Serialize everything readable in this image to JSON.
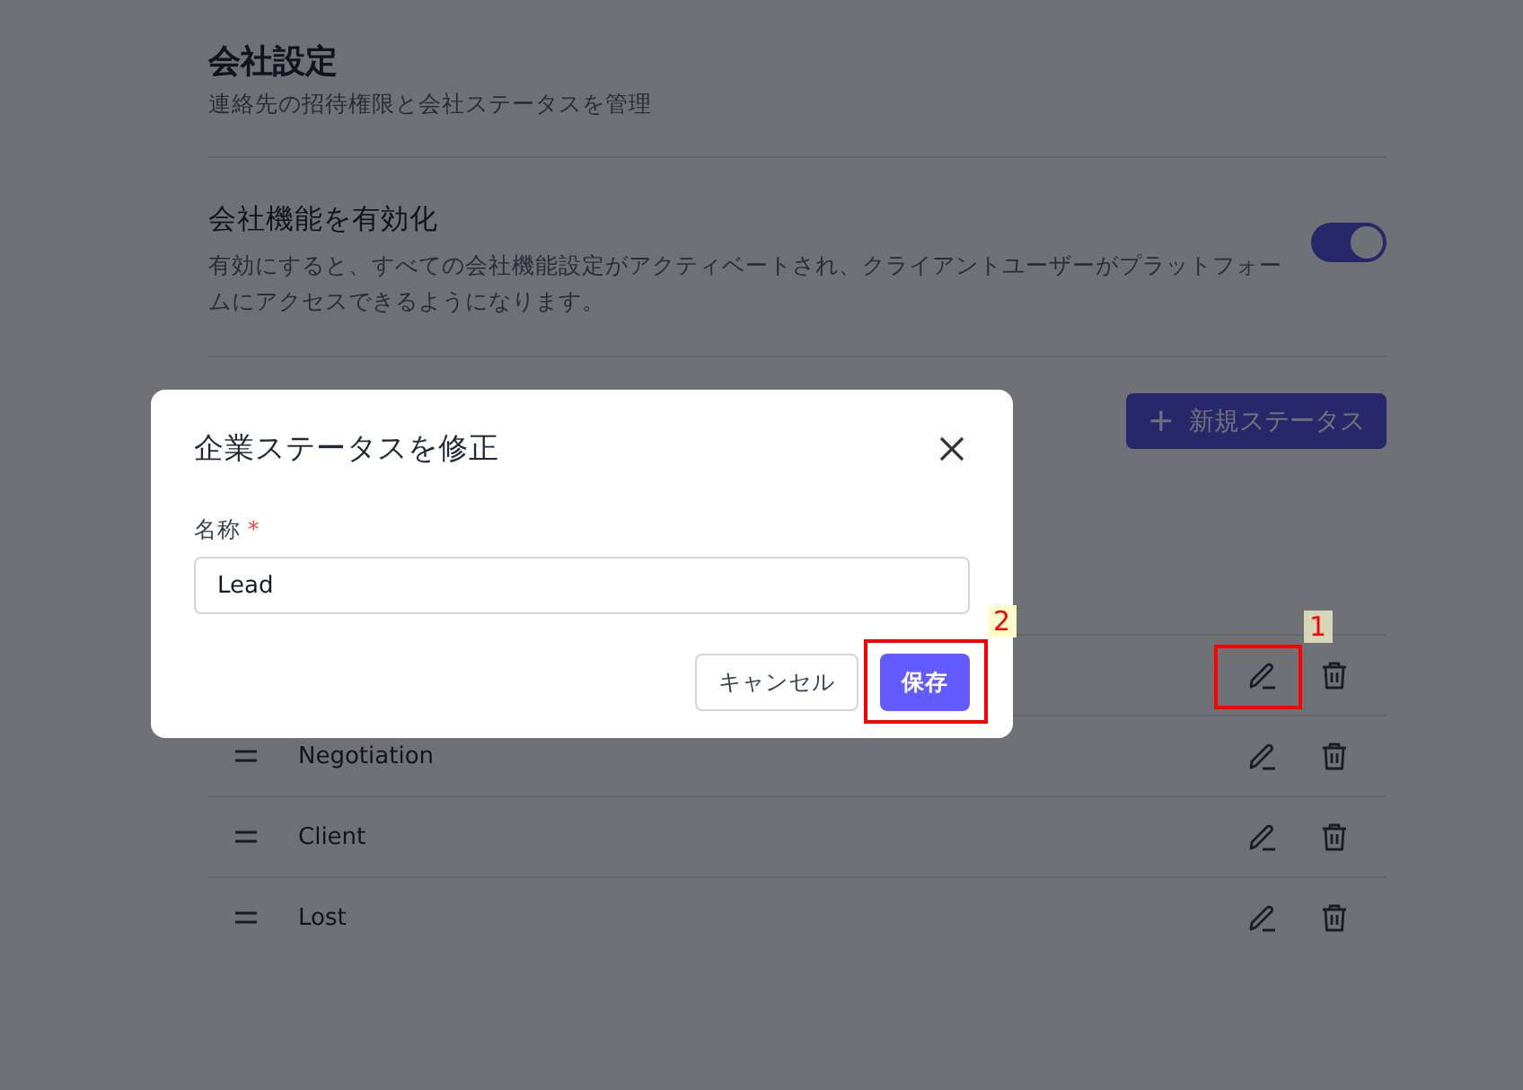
{
  "page": {
    "title": "会社設定",
    "subtitle": "連絡先の招待権限と会社ステータスを管理"
  },
  "feature": {
    "title": "会社機能を有効化",
    "description": "有効にすると、すべての会社機能設定がアクティベートされ、クライアントユーザーがプラットフォームにアクセスできるようになります。",
    "on": true
  },
  "statuses": {
    "new_button": {
      "icon": "+",
      "label": "新規ステータス"
    },
    "rows": [
      {},
      {
        "name": "Negotiation"
      },
      {
        "name": "Client"
      },
      {
        "name": "Lost"
      }
    ]
  },
  "modal": {
    "title": "企業ステータスを修正",
    "field_label": "名称",
    "required_mark": "*",
    "value": "Lead",
    "buttons": [
      {
        "kind": "secondary",
        "label": "キャンセル"
      },
      {
        "kind": "primary",
        "label": "保存"
      }
    ]
  },
  "annotations": [
    {
      "label": "2",
      "kind": "save"
    },
    {
      "label": "1",
      "kind": "edit"
    }
  ]
}
